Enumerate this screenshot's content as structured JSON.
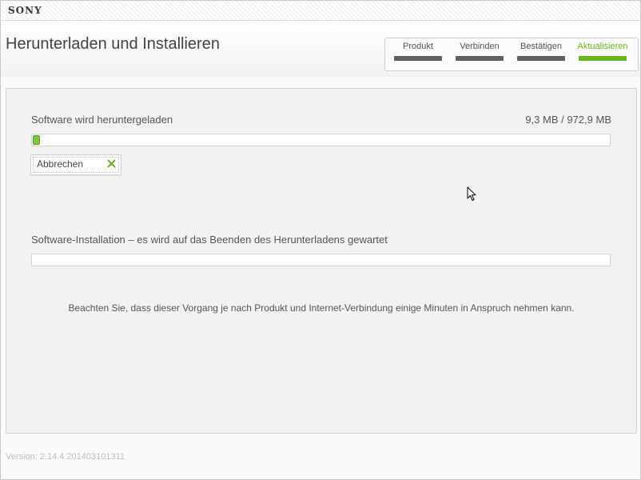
{
  "brand": "SONY",
  "page_title": "Herunterladen und Installieren",
  "steps": [
    {
      "label": "Produkt",
      "active": false
    },
    {
      "label": "Verbinden",
      "active": false
    },
    {
      "label": "Bestätigen",
      "active": false
    },
    {
      "label": "Aktualisieren",
      "active": true
    }
  ],
  "download": {
    "label": "Software wird heruntergeladen",
    "size_text": "9,3 MB / 972,9 MB",
    "progress_fraction": 0.0096,
    "cancel_label": "Abbrechen"
  },
  "install": {
    "label": "Software-Installation – es wird auf das Beenden des Herunterladens gewartet",
    "progress_fraction": 0
  },
  "note": "Beachten Sie, dass dieser Vorgang je nach Produkt und Internet-Verbindung einige Minuten in Anspruch nehmen kann.",
  "version": "Version: 2.14.4.201403101311",
  "icons": {
    "cancel": "close-icon",
    "cursor": "mouse-cursor-icon"
  },
  "colors": {
    "accent": "#6cb421",
    "step_inactive": "#5f5f5f",
    "progress_fill": "#7cc63a"
  }
}
